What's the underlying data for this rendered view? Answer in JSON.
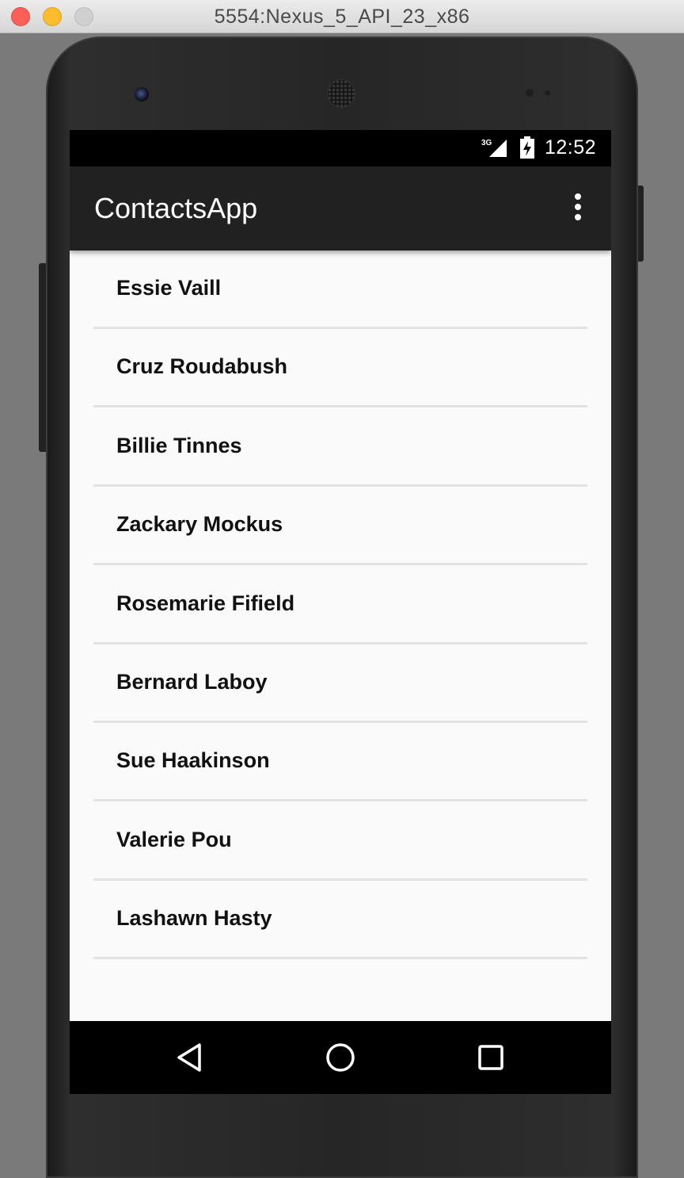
{
  "window": {
    "title": "5554:Nexus_5_API_23_x86"
  },
  "status_bar": {
    "network": "3G",
    "time": "12:52",
    "signal_icon": "cell-signal-icon",
    "battery_icon": "battery-charging-icon"
  },
  "app_bar": {
    "title": "ContactsApp",
    "overflow_icon": "more-vert-icon"
  },
  "contacts": [
    "Essie Vaill",
    "Cruz Roudabush",
    "Billie Tinnes",
    "Zackary Mockus",
    "Rosemarie Fifield",
    "Bernard Laboy",
    "Sue Haakinson",
    "Valerie Pou",
    "Lashawn Hasty"
  ],
  "nav_bar": {
    "back_icon": "back-triangle-icon",
    "home_icon": "home-circle-icon",
    "recents_icon": "recents-square-icon"
  },
  "colors": {
    "app_bar": "#212121",
    "list_background": "#fafafa",
    "divider": "#e2e2e2",
    "status_bar": "#000000"
  }
}
